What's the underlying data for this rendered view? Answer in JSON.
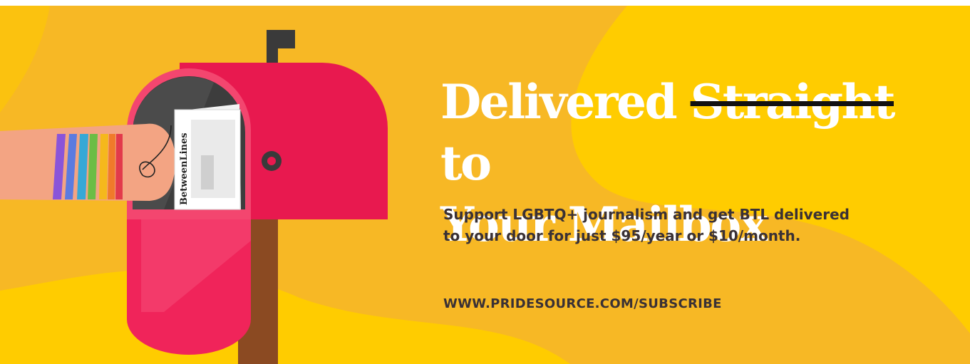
{
  "banner": {
    "headline": {
      "part1": "Delivered ",
      "struck": "Straight",
      "part2": " to",
      "line2": "Your Mailbox"
    },
    "subtext": {
      "line1": "Support LGBTQ+ journalism and get BTL delivered",
      "line2": "to your door for just $95/year or $10/month."
    },
    "url": "WWW.PRIDESOURCE.COM/SUBSCRIBE",
    "newspaper_title": "BetweenLines",
    "colors": {
      "background": "#f7b825",
      "accent_yellow": "#ffcc00",
      "mailbox_red": "#e8194f",
      "post_brown": "#8b4a22",
      "headline_text": "#ffffff",
      "body_text": "#3a3135"
    }
  }
}
